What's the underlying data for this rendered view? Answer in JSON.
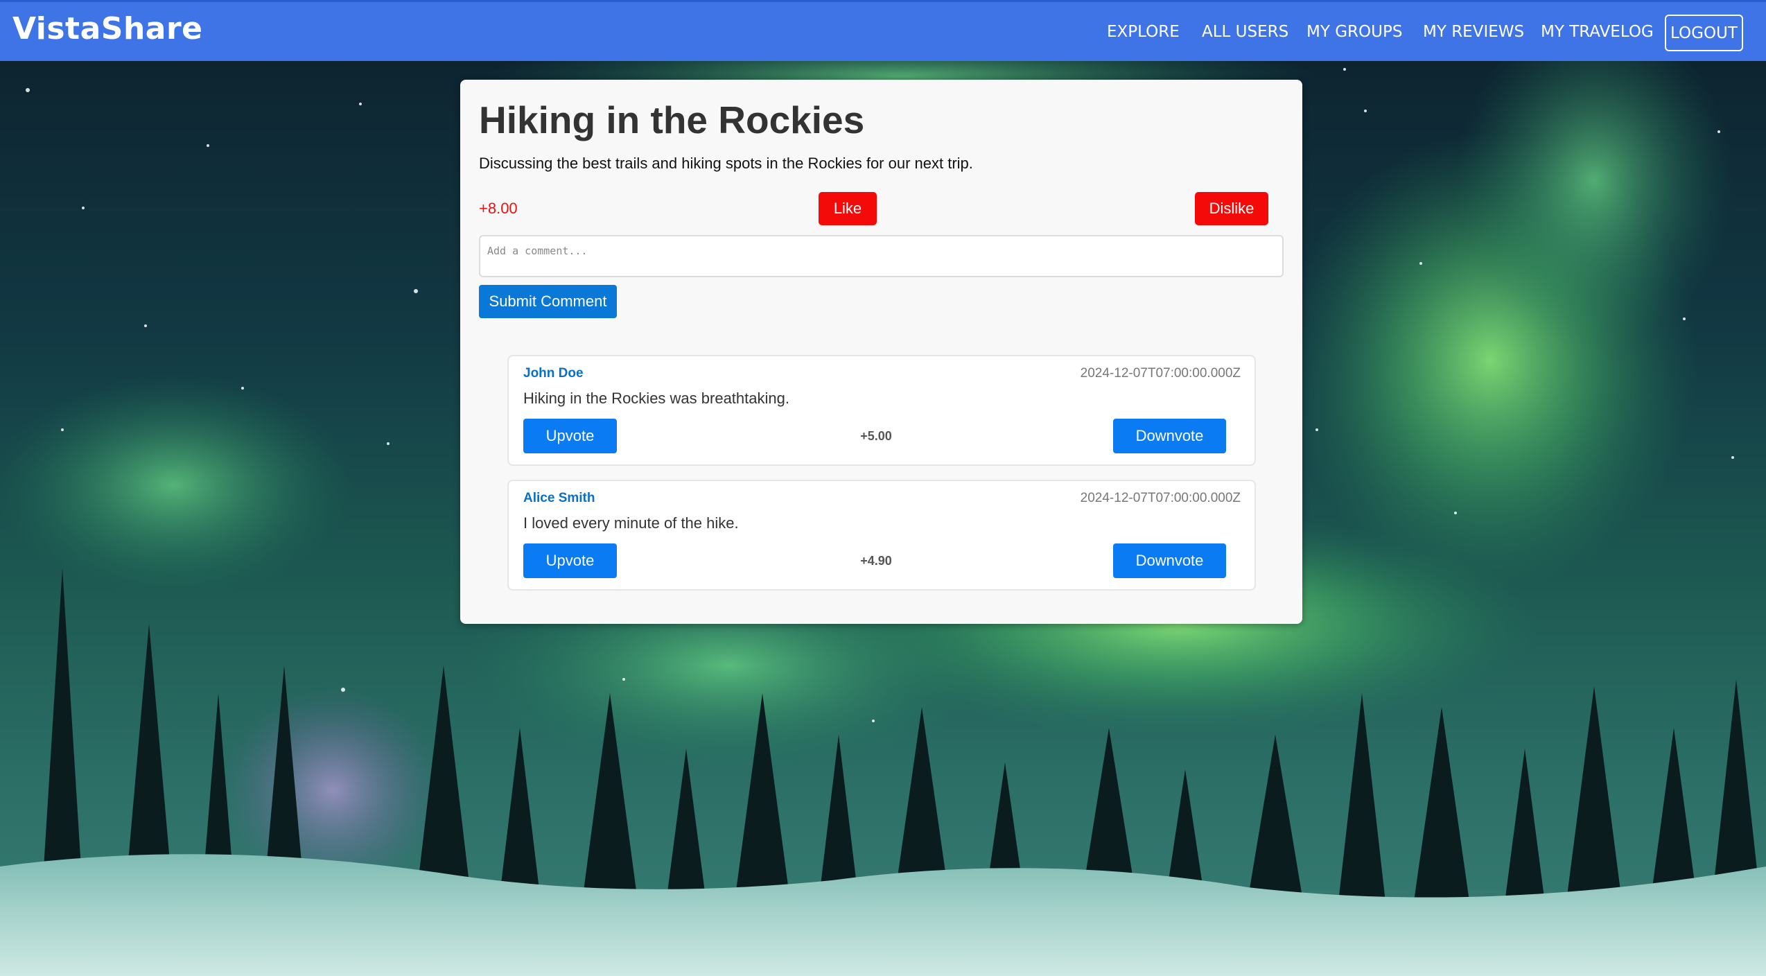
{
  "navbar": {
    "brand": "VistaShare",
    "links": [
      {
        "label": "EXPLORE"
      },
      {
        "label": "ALL USERS"
      },
      {
        "label": "MY GROUPS"
      },
      {
        "label": "MY REVIEWS"
      },
      {
        "label": "MY TRAVELOG"
      }
    ],
    "logout_label": "LOGOUT"
  },
  "post": {
    "title": "Hiking in the Rockies",
    "description": "Discussing the best trails and hiking spots in the Rockies for our next trip.",
    "score": "+8.00",
    "like_label": "Like",
    "dislike_label": "Dislike",
    "comment_placeholder": "Add a comment...",
    "submit_label": "Submit Comment"
  },
  "comments": [
    {
      "author": "John Doe",
      "date": "2024-12-07T07:00:00.000Z",
      "text": "Hiking in the Rockies was breathtaking.",
      "score": "+5.00",
      "upvote_label": "Upvote",
      "downvote_label": "Downvote"
    },
    {
      "author": "Alice Smith",
      "date": "2024-12-07T07:00:00.000Z",
      "text": "I loved every minute of the hike.",
      "score": "+4.90",
      "upvote_label": "Upvote",
      "downvote_label": "Downvote"
    }
  ],
  "colors": {
    "navbar": "#3f74e6",
    "like_button": "#f50a0a",
    "submit_button": "#0a78d6",
    "vote_button": "#0a7bf2",
    "author_link": "#0a6fc9",
    "score_text": "#ee1111"
  }
}
